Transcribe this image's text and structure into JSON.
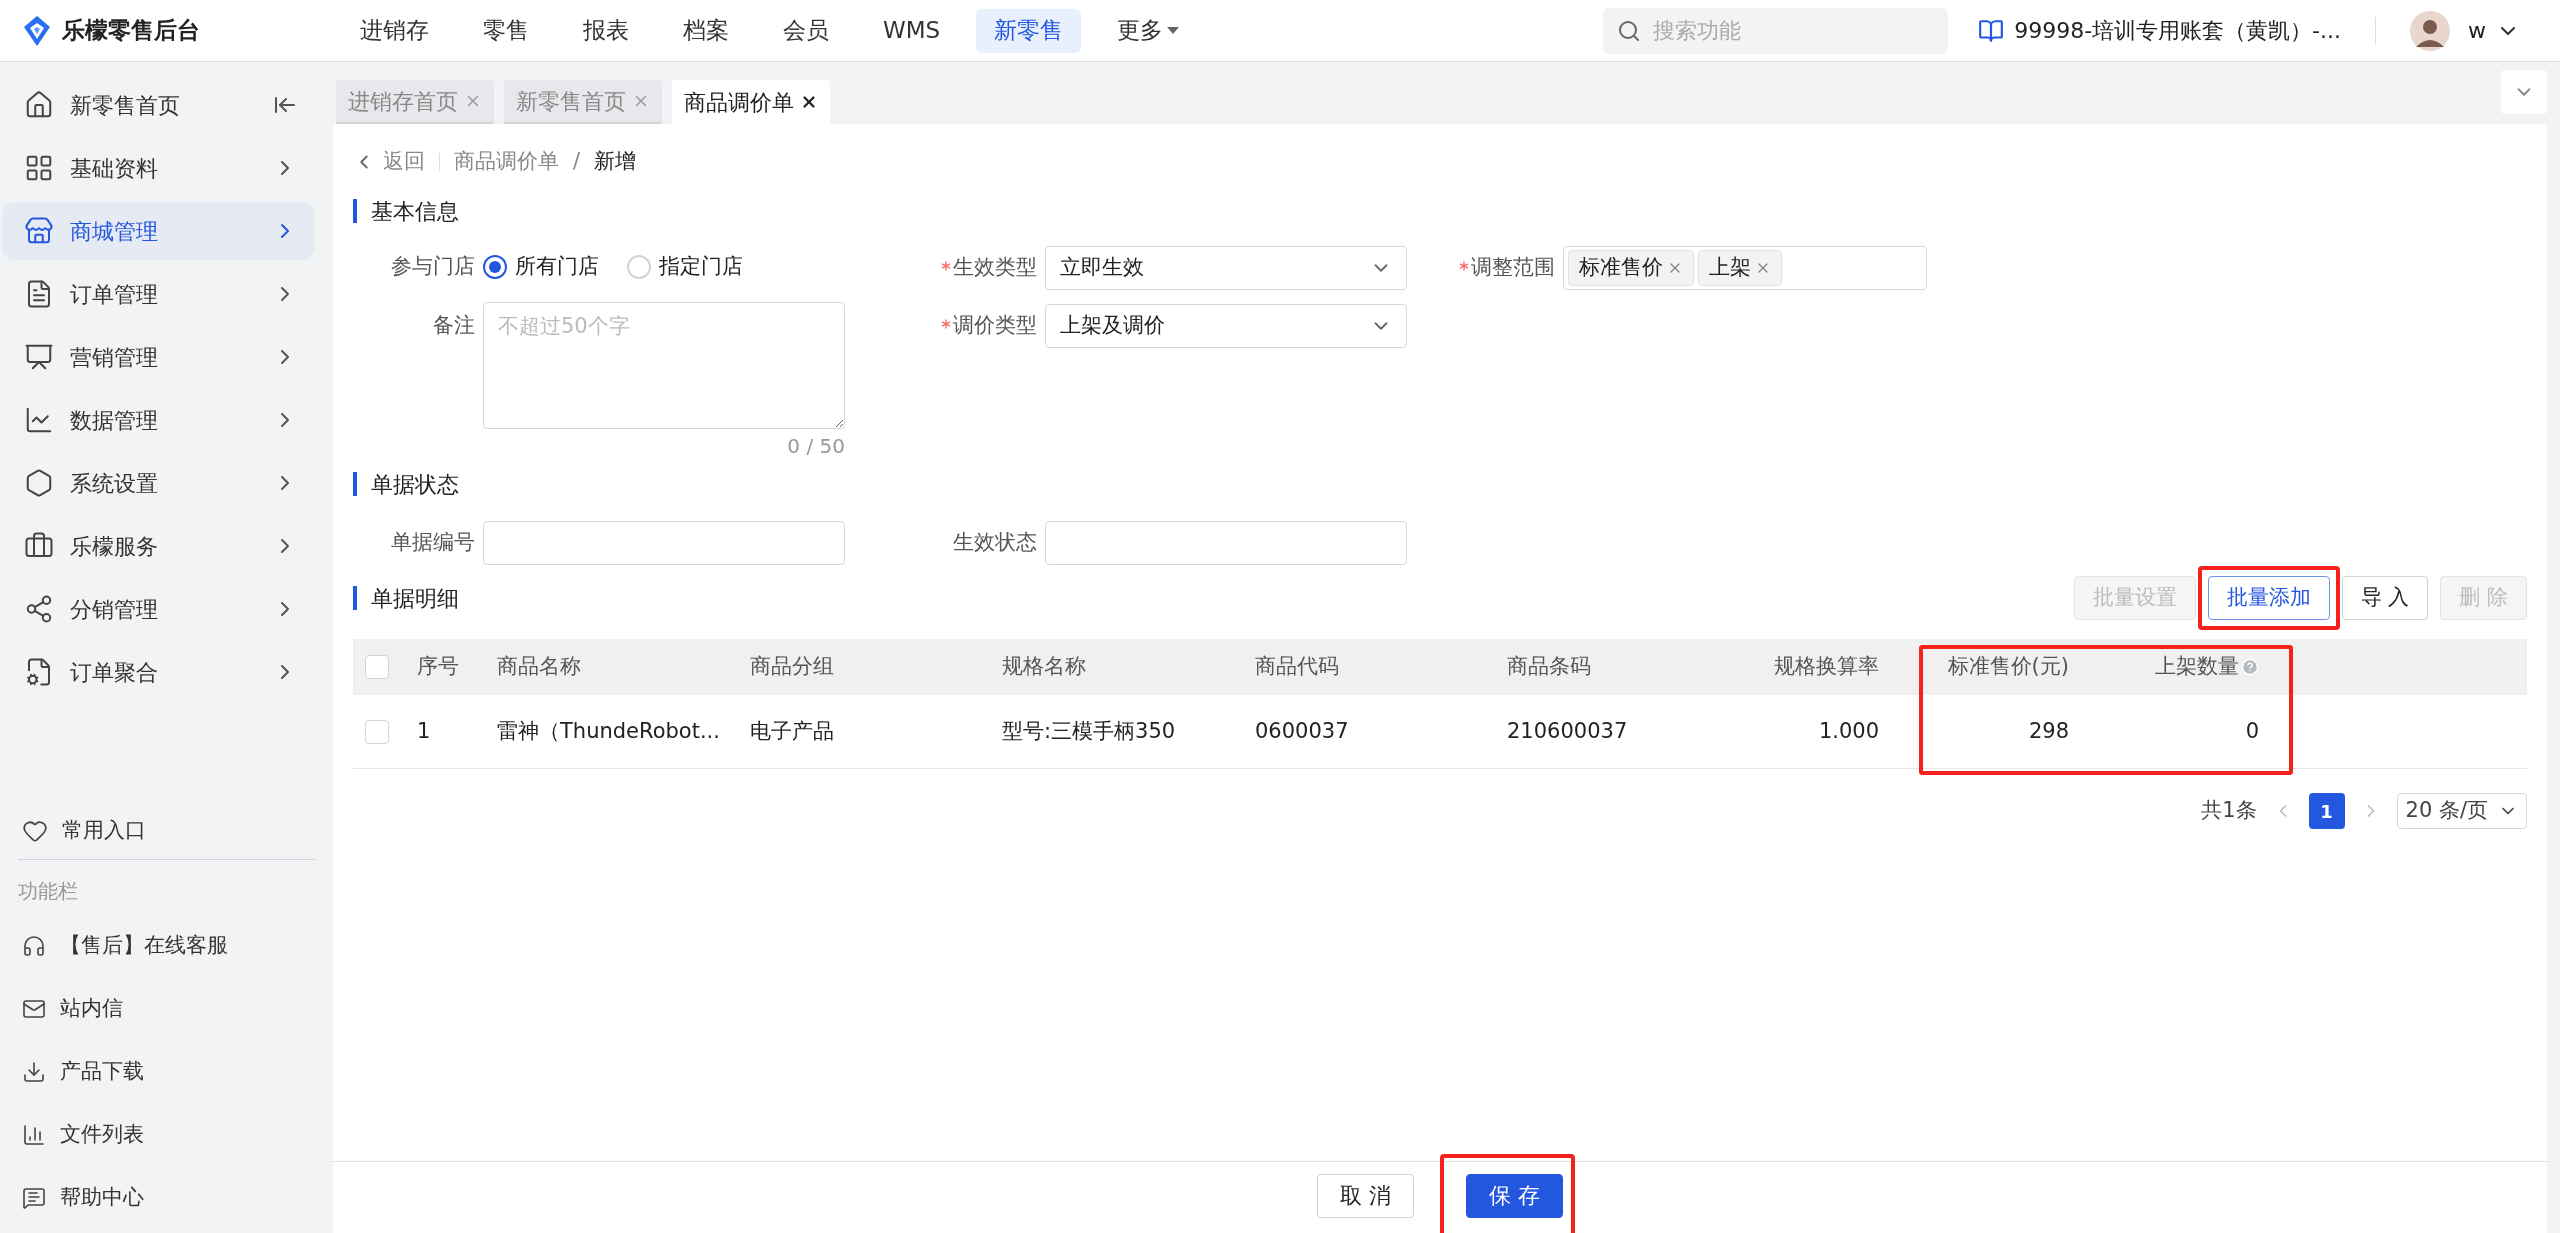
{
  "brand": {
    "name": "乐檬零售后台"
  },
  "top_nav": [
    {
      "label": "进销存",
      "selected": false,
      "kind": "link"
    },
    {
      "label": "零售",
      "selected": false,
      "kind": "link"
    },
    {
      "label": "报表",
      "selected": false,
      "kind": "link"
    },
    {
      "label": "档案",
      "selected": false,
      "kind": "link"
    },
    {
      "label": "会员",
      "selected": false,
      "kind": "link"
    },
    {
      "label": "WMS",
      "selected": false,
      "kind": "link"
    },
    {
      "label": "新零售",
      "selected": true,
      "kind": "link"
    },
    {
      "label": "更多",
      "selected": false,
      "kind": "dropdown"
    }
  ],
  "search": {
    "placeholder": "搜索功能"
  },
  "account": {
    "name": "99998-培训专用账套（黄凯）-...",
    "user": "w"
  },
  "sidebar": {
    "items": [
      {
        "label": "新零售首页",
        "selected": false,
        "kind": "link"
      },
      {
        "label": "基础资料",
        "selected": false,
        "kind": "group"
      },
      {
        "label": "商城管理",
        "selected": true,
        "kind": "group"
      },
      {
        "label": "订单管理",
        "selected": false,
        "kind": "group"
      },
      {
        "label": "营销管理",
        "selected": false,
        "kind": "group"
      },
      {
        "label": "数据管理",
        "selected": false,
        "kind": "group"
      },
      {
        "label": "系统设置",
        "selected": false,
        "kind": "group"
      },
      {
        "label": "乐檬服务",
        "selected": false,
        "kind": "group"
      },
      {
        "label": "分销管理",
        "selected": false,
        "kind": "group"
      },
      {
        "label": "订单聚合",
        "selected": false,
        "kind": "group"
      }
    ],
    "favorites": "常用入口",
    "section_title": "功能栏",
    "tools": [
      "【售后】在线客服",
      "站内信",
      "产品下载",
      "文件列表",
      "帮助中心"
    ]
  },
  "tabs": [
    {
      "label": "进销存首页",
      "selected": false
    },
    {
      "label": "新零售首页",
      "selected": false
    },
    {
      "label": "商品调价单",
      "selected": true
    }
  ],
  "breadcrumb": {
    "back": "返回",
    "path": "商品调价单",
    "separator": "/",
    "current": "新增"
  },
  "basic_info": {
    "title": "基本信息",
    "store": {
      "label": "参与门店",
      "options": [
        {
          "label": "所有门店",
          "selected": true
        },
        {
          "label": "指定门店",
          "selected": false
        }
      ]
    },
    "note": {
      "label": "备注",
      "placeholder": "不超过50个字",
      "counter": "0 / 50"
    },
    "effect_type": {
      "label": "生效类型",
      "required": true,
      "value": "立即生效"
    },
    "price_type": {
      "label": "调价类型",
      "required": true,
      "value": "上架及调价"
    },
    "scope": {
      "label": "调整范围",
      "required": true,
      "tags": [
        "标准售价",
        "上架"
      ]
    }
  },
  "status": {
    "title": "单据状态",
    "fields": [
      {
        "label": "单据编号"
      },
      {
        "label": "生效状态"
      }
    ]
  },
  "details": {
    "title": "单据明细",
    "buttons": [
      {
        "label": "批量设置",
        "disabled": true,
        "kind": "default",
        "highlighted": false
      },
      {
        "label": "批量添加",
        "disabled": false,
        "kind": "outline",
        "highlighted": true
      },
      {
        "label": "导 入",
        "disabled": false,
        "kind": "default",
        "highlighted": false
      },
      {
        "label": "删 除",
        "disabled": true,
        "kind": "default",
        "highlighted": false
      }
    ],
    "table": {
      "all_checked": false,
      "columns": [
        {
          "label": "序号",
          "highlighted": false,
          "help": false
        },
        {
          "label": "商品名称",
          "highlighted": false,
          "help": false
        },
        {
          "label": "商品分组",
          "highlighted": false,
          "help": false
        },
        {
          "label": "规格名称",
          "highlighted": false,
          "help": false
        },
        {
          "label": "商品代码",
          "highlighted": false,
          "help": false
        },
        {
          "label": "商品条码",
          "highlighted": false,
          "help": false
        },
        {
          "label": "规格换算率",
          "highlighted": false,
          "help": false
        },
        {
          "label": "标准售价(元)",
          "highlighted": true,
          "help": false
        },
        {
          "label": "上架数量",
          "highlighted": true,
          "help": true
        }
      ],
      "rows": [
        {
          "checked": false,
          "cells": [
            "1",
            "雷神（ThundeRobot...",
            "电子产品",
            "型号:三模手柄350",
            "0600037",
            "210600037",
            "1.000",
            "298",
            "0"
          ]
        }
      ]
    },
    "pagination": {
      "total": "共1条",
      "pages": [
        {
          "label": "1",
          "selected": true
        }
      ],
      "page_size": "20 条/页"
    }
  },
  "footer": {
    "buttons": [
      {
        "label": "取 消",
        "kind": "default",
        "highlighted": false
      },
      {
        "label": "保 存",
        "kind": "primary",
        "highlighted": true
      }
    ]
  }
}
